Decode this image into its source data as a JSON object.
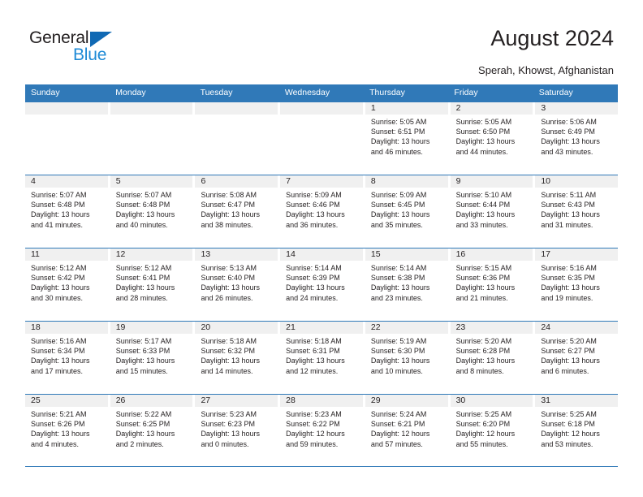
{
  "brand": {
    "name_part1": "General",
    "name_part2": "Blue",
    "logo_icon": "triangle-icon",
    "accent_blue": "#1e8ad6",
    "triangle_blue": "#1069b4"
  },
  "header": {
    "title": "August 2024",
    "location": "Sperah, Khowst, Afghanistan"
  },
  "calendar": {
    "header_bg": "#3079b8",
    "cell_head_bg": "#f0f0f0",
    "weekdays": [
      "Sunday",
      "Monday",
      "Tuesday",
      "Wednesday",
      "Thursday",
      "Friday",
      "Saturday"
    ],
    "weeks": [
      [
        {
          "day": "",
          "sunrise": "",
          "sunset": "",
          "daylight_line1": "",
          "daylight_line2": "",
          "empty": true
        },
        {
          "day": "",
          "sunrise": "",
          "sunset": "",
          "daylight_line1": "",
          "daylight_line2": "",
          "empty": true
        },
        {
          "day": "",
          "sunrise": "",
          "sunset": "",
          "daylight_line1": "",
          "daylight_line2": "",
          "empty": true
        },
        {
          "day": "",
          "sunrise": "",
          "sunset": "",
          "daylight_line1": "",
          "daylight_line2": "",
          "empty": true
        },
        {
          "day": "1",
          "sunrise": "Sunrise: 5:05 AM",
          "sunset": "Sunset: 6:51 PM",
          "daylight_line1": "Daylight: 13 hours",
          "daylight_line2": "and 46 minutes."
        },
        {
          "day": "2",
          "sunrise": "Sunrise: 5:05 AM",
          "sunset": "Sunset: 6:50 PM",
          "daylight_line1": "Daylight: 13 hours",
          "daylight_line2": "and 44 minutes."
        },
        {
          "day": "3",
          "sunrise": "Sunrise: 5:06 AM",
          "sunset": "Sunset: 6:49 PM",
          "daylight_line1": "Daylight: 13 hours",
          "daylight_line2": "and 43 minutes."
        }
      ],
      [
        {
          "day": "4",
          "sunrise": "Sunrise: 5:07 AM",
          "sunset": "Sunset: 6:48 PM",
          "daylight_line1": "Daylight: 13 hours",
          "daylight_line2": "and 41 minutes."
        },
        {
          "day": "5",
          "sunrise": "Sunrise: 5:07 AM",
          "sunset": "Sunset: 6:48 PM",
          "daylight_line1": "Daylight: 13 hours",
          "daylight_line2": "and 40 minutes."
        },
        {
          "day": "6",
          "sunrise": "Sunrise: 5:08 AM",
          "sunset": "Sunset: 6:47 PM",
          "daylight_line1": "Daylight: 13 hours",
          "daylight_line2": "and 38 minutes."
        },
        {
          "day": "7",
          "sunrise": "Sunrise: 5:09 AM",
          "sunset": "Sunset: 6:46 PM",
          "daylight_line1": "Daylight: 13 hours",
          "daylight_line2": "and 36 minutes."
        },
        {
          "day": "8",
          "sunrise": "Sunrise: 5:09 AM",
          "sunset": "Sunset: 6:45 PM",
          "daylight_line1": "Daylight: 13 hours",
          "daylight_line2": "and 35 minutes."
        },
        {
          "day": "9",
          "sunrise": "Sunrise: 5:10 AM",
          "sunset": "Sunset: 6:44 PM",
          "daylight_line1": "Daylight: 13 hours",
          "daylight_line2": "and 33 minutes."
        },
        {
          "day": "10",
          "sunrise": "Sunrise: 5:11 AM",
          "sunset": "Sunset: 6:43 PM",
          "daylight_line1": "Daylight: 13 hours",
          "daylight_line2": "and 31 minutes."
        }
      ],
      [
        {
          "day": "11",
          "sunrise": "Sunrise: 5:12 AM",
          "sunset": "Sunset: 6:42 PM",
          "daylight_line1": "Daylight: 13 hours",
          "daylight_line2": "and 30 minutes."
        },
        {
          "day": "12",
          "sunrise": "Sunrise: 5:12 AM",
          "sunset": "Sunset: 6:41 PM",
          "daylight_line1": "Daylight: 13 hours",
          "daylight_line2": "and 28 minutes."
        },
        {
          "day": "13",
          "sunrise": "Sunrise: 5:13 AM",
          "sunset": "Sunset: 6:40 PM",
          "daylight_line1": "Daylight: 13 hours",
          "daylight_line2": "and 26 minutes."
        },
        {
          "day": "14",
          "sunrise": "Sunrise: 5:14 AM",
          "sunset": "Sunset: 6:39 PM",
          "daylight_line1": "Daylight: 13 hours",
          "daylight_line2": "and 24 minutes."
        },
        {
          "day": "15",
          "sunrise": "Sunrise: 5:14 AM",
          "sunset": "Sunset: 6:38 PM",
          "daylight_line1": "Daylight: 13 hours",
          "daylight_line2": "and 23 minutes."
        },
        {
          "day": "16",
          "sunrise": "Sunrise: 5:15 AM",
          "sunset": "Sunset: 6:36 PM",
          "daylight_line1": "Daylight: 13 hours",
          "daylight_line2": "and 21 minutes."
        },
        {
          "day": "17",
          "sunrise": "Sunrise: 5:16 AM",
          "sunset": "Sunset: 6:35 PM",
          "daylight_line1": "Daylight: 13 hours",
          "daylight_line2": "and 19 minutes."
        }
      ],
      [
        {
          "day": "18",
          "sunrise": "Sunrise: 5:16 AM",
          "sunset": "Sunset: 6:34 PM",
          "daylight_line1": "Daylight: 13 hours",
          "daylight_line2": "and 17 minutes."
        },
        {
          "day": "19",
          "sunrise": "Sunrise: 5:17 AM",
          "sunset": "Sunset: 6:33 PM",
          "daylight_line1": "Daylight: 13 hours",
          "daylight_line2": "and 15 minutes."
        },
        {
          "day": "20",
          "sunrise": "Sunrise: 5:18 AM",
          "sunset": "Sunset: 6:32 PM",
          "daylight_line1": "Daylight: 13 hours",
          "daylight_line2": "and 14 minutes."
        },
        {
          "day": "21",
          "sunrise": "Sunrise: 5:18 AM",
          "sunset": "Sunset: 6:31 PM",
          "daylight_line1": "Daylight: 13 hours",
          "daylight_line2": "and 12 minutes."
        },
        {
          "day": "22",
          "sunrise": "Sunrise: 5:19 AM",
          "sunset": "Sunset: 6:30 PM",
          "daylight_line1": "Daylight: 13 hours",
          "daylight_line2": "and 10 minutes."
        },
        {
          "day": "23",
          "sunrise": "Sunrise: 5:20 AM",
          "sunset": "Sunset: 6:28 PM",
          "daylight_line1": "Daylight: 13 hours",
          "daylight_line2": "and 8 minutes."
        },
        {
          "day": "24",
          "sunrise": "Sunrise: 5:20 AM",
          "sunset": "Sunset: 6:27 PM",
          "daylight_line1": "Daylight: 13 hours",
          "daylight_line2": "and 6 minutes."
        }
      ],
      [
        {
          "day": "25",
          "sunrise": "Sunrise: 5:21 AM",
          "sunset": "Sunset: 6:26 PM",
          "daylight_line1": "Daylight: 13 hours",
          "daylight_line2": "and 4 minutes."
        },
        {
          "day": "26",
          "sunrise": "Sunrise: 5:22 AM",
          "sunset": "Sunset: 6:25 PM",
          "daylight_line1": "Daylight: 13 hours",
          "daylight_line2": "and 2 minutes."
        },
        {
          "day": "27",
          "sunrise": "Sunrise: 5:23 AM",
          "sunset": "Sunset: 6:23 PM",
          "daylight_line1": "Daylight: 13 hours",
          "daylight_line2": "and 0 minutes."
        },
        {
          "day": "28",
          "sunrise": "Sunrise: 5:23 AM",
          "sunset": "Sunset: 6:22 PM",
          "daylight_line1": "Daylight: 12 hours",
          "daylight_line2": "and 59 minutes."
        },
        {
          "day": "29",
          "sunrise": "Sunrise: 5:24 AM",
          "sunset": "Sunset: 6:21 PM",
          "daylight_line1": "Daylight: 12 hours",
          "daylight_line2": "and 57 minutes."
        },
        {
          "day": "30",
          "sunrise": "Sunrise: 5:25 AM",
          "sunset": "Sunset: 6:20 PM",
          "daylight_line1": "Daylight: 12 hours",
          "daylight_line2": "and 55 minutes."
        },
        {
          "day": "31",
          "sunrise": "Sunrise: 5:25 AM",
          "sunset": "Sunset: 6:18 PM",
          "daylight_line1": "Daylight: 12 hours",
          "daylight_line2": "and 53 minutes."
        }
      ]
    ]
  }
}
